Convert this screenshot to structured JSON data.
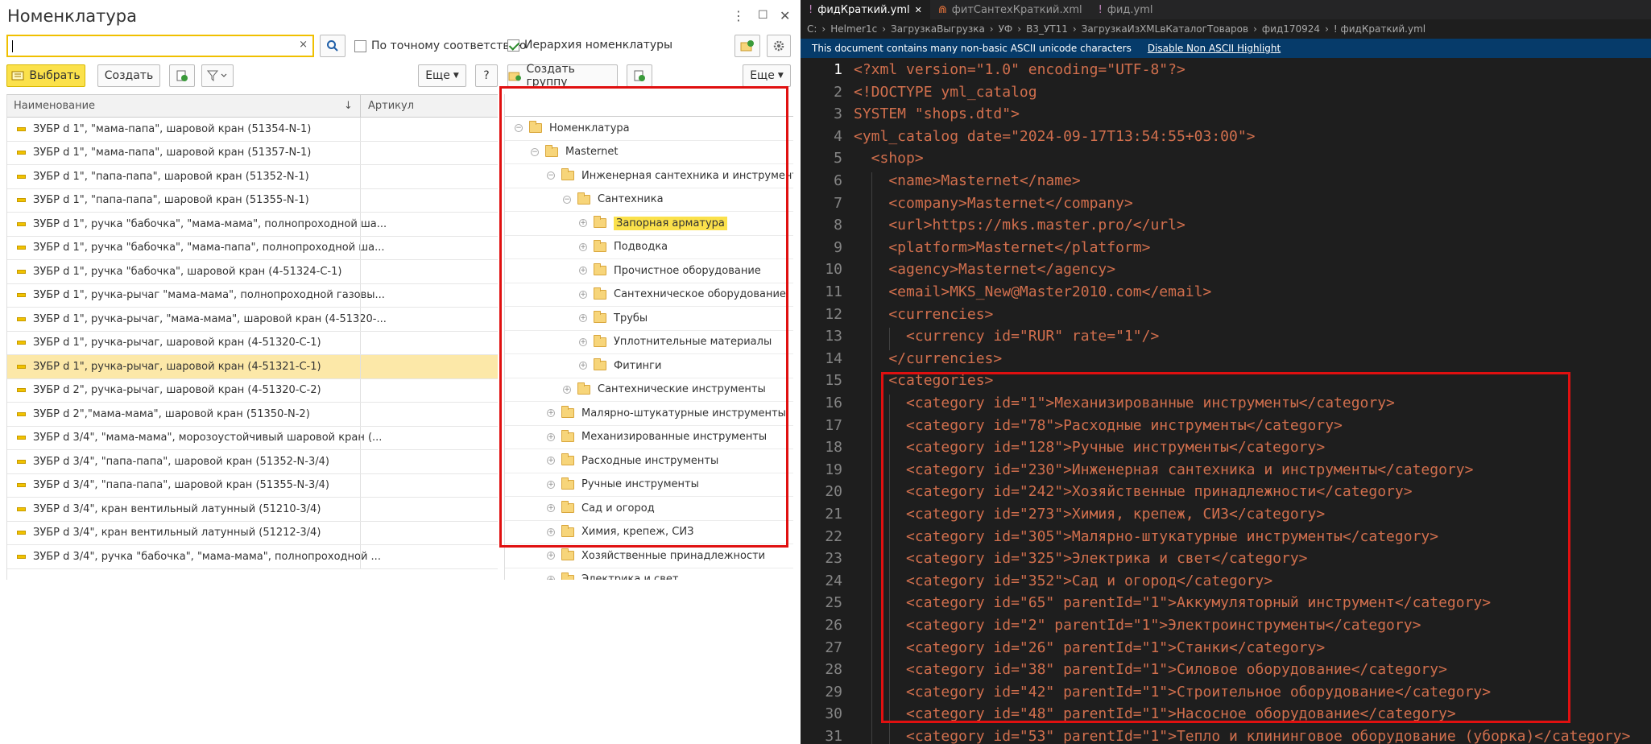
{
  "left": {
    "title": "Номенклатура",
    "window_controls": [
      "⋮",
      "☐",
      "✕"
    ],
    "search": {
      "value": "",
      "clear_glyph": "×"
    },
    "exact_match_label": "По точному соответствию",
    "hierarchy_label": "Иерархия номенклатуры",
    "select_btn": "Выбрать",
    "create_btn": "Создать",
    "more_btn": "Еще",
    "help_btn": "?",
    "create_group_btn": "Создать группу",
    "more_btn2": "Еще",
    "columns": {
      "name": "Наименование",
      "sort": "↓",
      "article": "Артикул"
    },
    "rows": [
      "ЗУБР d 1\", \"мама-папа\", шаровой кран (51354-N-1)",
      "ЗУБР d 1\", \"мама-папа\", шаровой кран (51357-N-1)",
      "ЗУБР d 1\", \"папа-папа\", шаровой кран (51352-N-1)",
      "ЗУБР d 1\", \"папа-папа\", шаровой кран (51355-N-1)",
      "ЗУБР d 1\", ручка \"бабочка\", \"мама-мама\", полнопроходной ша...",
      "ЗУБР d 1\", ручка \"бабочка\", \"мама-папа\", полнопроходной ша...",
      "ЗУБР d 1\", ручка \"бабочка\", шаровой кран (4-51324-C-1)",
      "ЗУБР d 1\", ручка-рычаг \"мама-мама\", полнопроходной газовы...",
      "ЗУБР d 1\", ручка-рычаг, \"мама-мама\", шаровой кран (4-51320-...",
      "ЗУБР d 1\", ручка-рычаг, шаровой кран (4-51320-C-1)",
      "ЗУБР d 1\", ручка-рычаг, шаровой кран (4-51321-C-1)",
      "ЗУБР d 2\", ручка-рычаг, шаровой кран (4-51320-C-2)",
      "ЗУБР d 2\",\"мама-мама\", шаровой кран (51350-N-2)",
      "ЗУБР d 3/4\", \"мама-мама\", морозоустойчивый шаровой кран (...",
      "ЗУБР d 3/4\", \"папа-папа\", шаровой кран (51352-N-3/4)",
      "ЗУБР d 3/4\", \"папа-папа\", шаровой кран (51355-N-3/4)",
      "ЗУБР d 3/4\", кран вентильный латунный (51210-3/4)",
      "ЗУБР d 3/4\", кран вентильный латунный (51212-3/4)",
      "ЗУБР d 3/4\", ручка \"бабочка\", \"мама-мама\", полнопроходной ..."
    ],
    "selected_row": 10,
    "tree": [
      {
        "label": "Номенклатура",
        "level": 0,
        "toggle": "⊖"
      },
      {
        "label": "Masternet",
        "level": 1,
        "toggle": "⊖"
      },
      {
        "label": "Инженерная сантехника и инструменты",
        "level": 2,
        "toggle": "⊖"
      },
      {
        "label": "Сантехника",
        "level": 3,
        "toggle": "⊖"
      },
      {
        "label": "Запорная арматура",
        "level": 4,
        "toggle": "⊕",
        "highlight": true
      },
      {
        "label": "Подводка",
        "level": 4,
        "toggle": "⊕"
      },
      {
        "label": "Прочистное оборудование",
        "level": 4,
        "toggle": "⊕"
      },
      {
        "label": "Сантехническое оборудование",
        "level": 4,
        "toggle": "⊕"
      },
      {
        "label": "Трубы",
        "level": 4,
        "toggle": "⊕"
      },
      {
        "label": "Уплотнительные материалы",
        "level": 4,
        "toggle": "⊕"
      },
      {
        "label": "Фитинги",
        "level": 4,
        "toggle": "⊕"
      },
      {
        "label": "Сантехнические инструменты",
        "level": 3,
        "toggle": "⊕"
      },
      {
        "label": "Малярно-штукатурные инструменты",
        "level": 2,
        "toggle": "⊕"
      },
      {
        "label": "Механизированные инструменты",
        "level": 2,
        "toggle": "⊕"
      },
      {
        "label": "Расходные инструменты",
        "level": 2,
        "toggle": "⊕"
      },
      {
        "label": "Ручные инструменты",
        "level": 2,
        "toggle": "⊕"
      },
      {
        "label": "Сад и огород",
        "level": 2,
        "toggle": "⊕"
      },
      {
        "label": "Химия, крепеж, СИЗ",
        "level": 2,
        "toggle": "⊕"
      },
      {
        "label": "Хозяйственные принадлежности",
        "level": 2,
        "toggle": "⊕"
      },
      {
        "label": "Электрика и свет",
        "level": 2,
        "toggle": "⊕"
      }
    ]
  },
  "editor": {
    "tabs": [
      {
        "label": "фидКраткий.yml",
        "icon": "!",
        "close": "✕",
        "active": true
      },
      {
        "label": "фитСантехКраткий.xml",
        "icon": "⋒",
        "active": false
      },
      {
        "label": "фид.yml",
        "icon": "!",
        "active": false
      }
    ],
    "breadcrumb": [
      "C:",
      "Helmer1c",
      "ЗагрузкаВыгрузка",
      "УФ",
      "В3_УТ11",
      "ЗагрузкаИзXMLвКаталогТоваров",
      "фид170924",
      "! фидКраткий.yml"
    ],
    "banner_text": "This document contains many non-basic ASCII unicode characters",
    "banner_link": "Disable Non ASCII Highlight",
    "lines": [
      "<?xml version=\"1.0\" encoding=\"UTF-8\"?>",
      "<!DOCTYPE yml_catalog",
      "SYSTEM \"shops.dtd\">",
      "<yml_catalog date=\"2024-09-17T13:54:55+03:00\">",
      "  <shop>",
      "    <name>Masternet</name>",
      "    <company>Masternet</company>",
      "    <url>https://mks.master.pro/</url>",
      "    <platform>Masternet</platform>",
      "    <agency>Masternet</agency>",
      "    <email>MKS_New@Master2010.com</email>",
      "    <currencies>",
      "      <currency id=\"RUR\" rate=\"1\"/>",
      "    </currencies>",
      "    <categories>",
      "      <category id=\"1\">Механизированные инструменты</category>",
      "      <category id=\"78\">Расходные инструменты</category>",
      "      <category id=\"128\">Ручные инструменты</category>",
      "      <category id=\"230\">Инженерная сантехника и инструменты</category>",
      "      <category id=\"242\">Хозяйственные принадлежности</category>",
      "      <category id=\"273\">Химия, крепеж, СИЗ</category>",
      "      <category id=\"305\">Малярно-штукатурные инструменты</category>",
      "      <category id=\"325\">Электрика и свет</category>",
      "      <category id=\"352\">Сад и огород</category>",
      "      <category id=\"65\" parentId=\"1\">Аккумуляторный инструмент</category>",
      "      <category id=\"2\" parentId=\"1\">Электроинструменты</category>",
      "      <category id=\"26\" parentId=\"1\">Станки</category>",
      "      <category id=\"38\" parentId=\"1\">Силовое оборудование</category>",
      "      <category id=\"42\" parentId=\"1\">Строительное оборудование</category>",
      "      <category id=\"48\" parentId=\"1\">Насосное оборудование</category>",
      "      <category id=\"53\" parentId=\"1\">Тепло и клининговое оборудование (уборка)</category>"
    ],
    "current_line": 1
  }
}
